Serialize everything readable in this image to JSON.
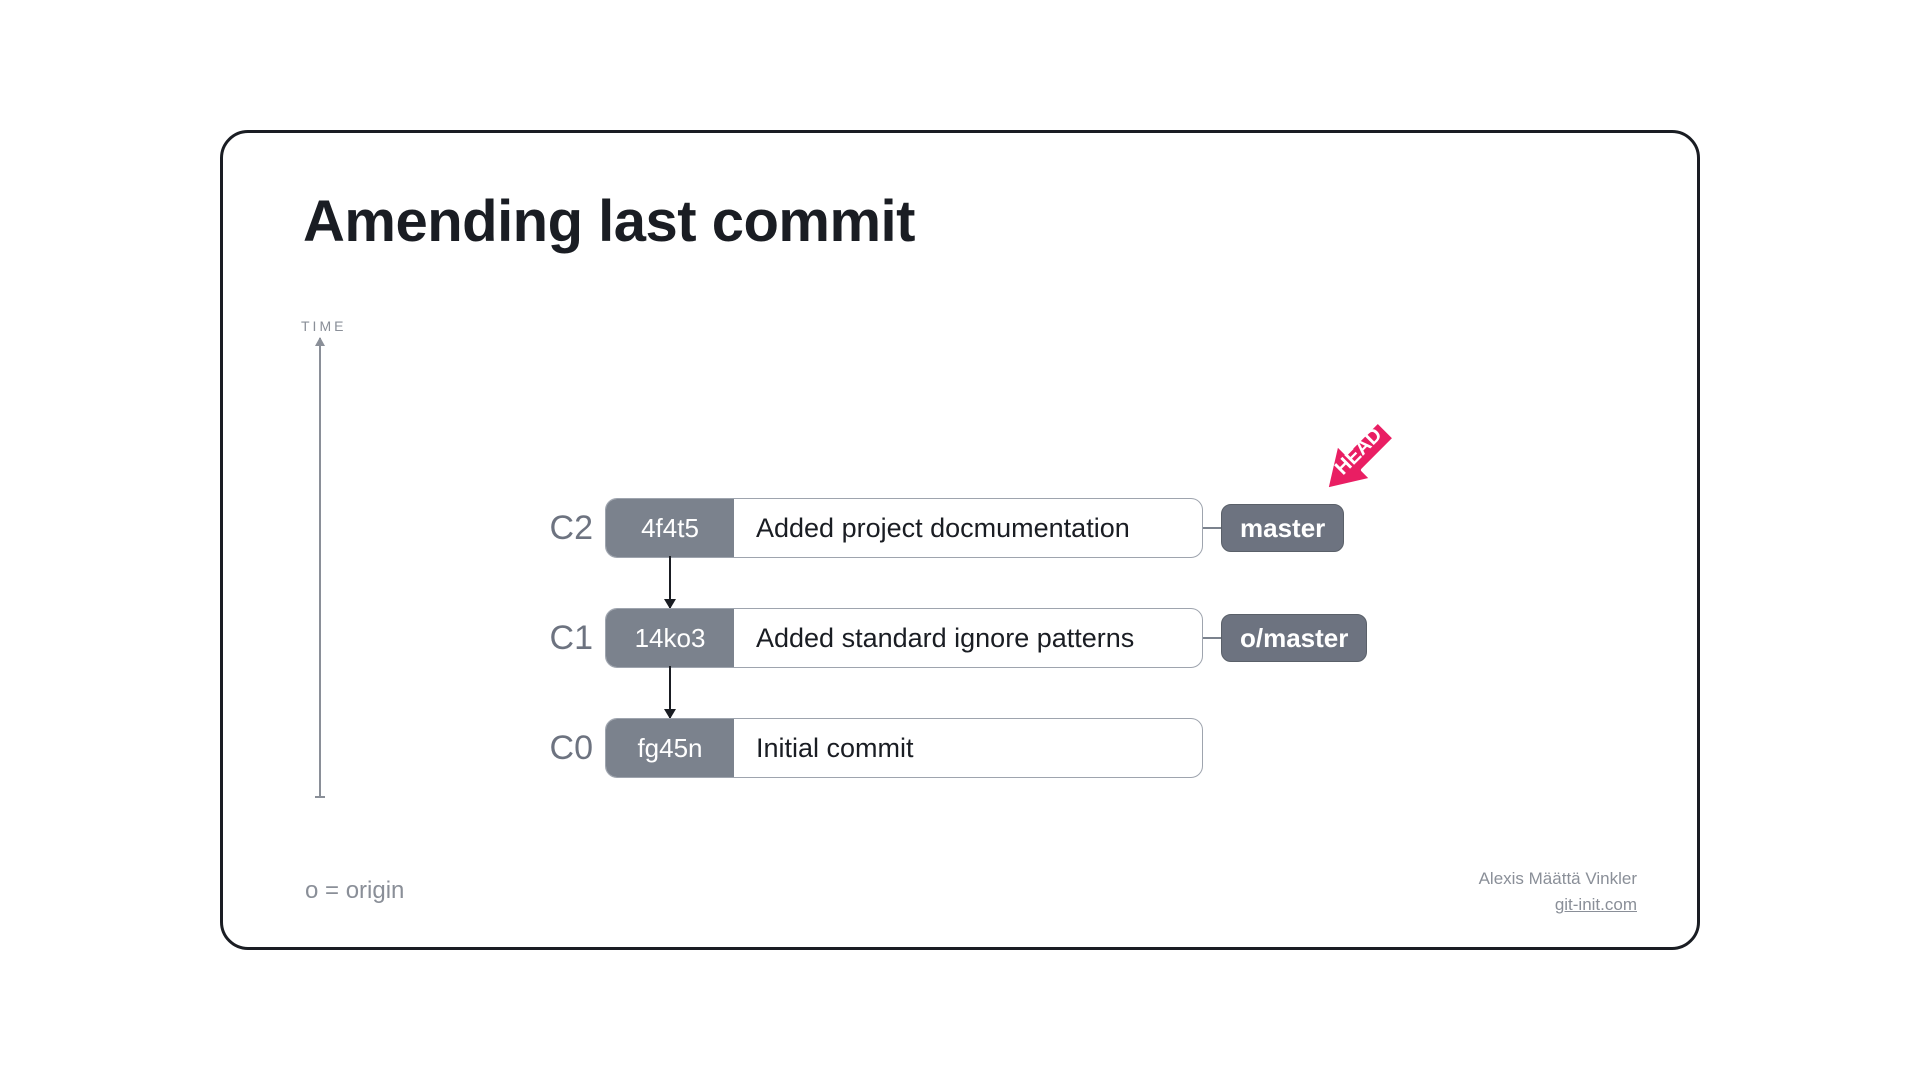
{
  "title": "Amending last commit",
  "time_label": "TIME",
  "commits": [
    {
      "label": "C2",
      "hash": "4f4t5",
      "message": "Added project docmumentation",
      "branch": "master",
      "head": true
    },
    {
      "label": "C1",
      "hash": "14ko3",
      "message": "Added standard ignore patterns",
      "branch": "o/master",
      "head": false
    },
    {
      "label": "C0",
      "hash": "fg45n",
      "message": "Initial commit",
      "branch": null,
      "head": false
    }
  ],
  "head_label": "HEAD",
  "legend": "o = origin",
  "credits": {
    "author": "Alexis Määttä Vinkler",
    "site": "git-init.com"
  }
}
